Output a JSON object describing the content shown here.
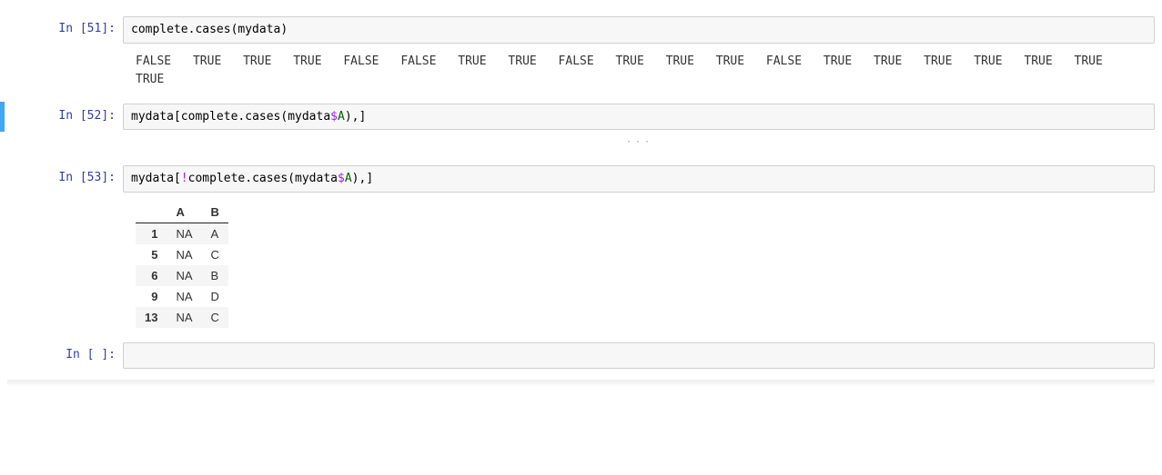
{
  "cells": {
    "c51": {
      "prompt": "In [51]:",
      "code": {
        "fn": "complete.cases",
        "lpar": "(",
        "arg": "mydata",
        "rpar": ")"
      },
      "output_text": "FALSE TRUE TRUE TRUE FALSE FALSE TRUE TRUE FALSE TRUE TRUE TRUE FALSE TRUE TRUE TRUE TRUE TRUE TRUE TRUE"
    },
    "c52": {
      "prompt": "In [52]:",
      "code": {
        "obj": "mydata",
        "lbrk": "[",
        "fn": "complete.cases",
        "lpar": "(",
        "arg": "mydata",
        "dollar": "$",
        "field": "A",
        "rpar": ")",
        "comma": ",",
        "rbrk": "]"
      },
      "ellipsis": "···"
    },
    "c53": {
      "prompt": "In [53]:",
      "code": {
        "obj": "mydata",
        "lbrk": "[",
        "bang": "!",
        "fn": "complete.cases",
        "lpar": "(",
        "arg": "mydata",
        "dollar": "$",
        "field": "A",
        "rpar": ")",
        "comma": ",",
        "rbrk": "]"
      },
      "table": {
        "columns": [
          "A",
          "B"
        ],
        "rows": [
          {
            "idx": "1",
            "A": "NA",
            "B": "A"
          },
          {
            "idx": "5",
            "A": "NA",
            "B": "C"
          },
          {
            "idx": "6",
            "A": "NA",
            "B": "B"
          },
          {
            "idx": "9",
            "A": "NA",
            "B": "D"
          },
          {
            "idx": "13",
            "A": "NA",
            "B": "C"
          }
        ]
      }
    },
    "c_empty": {
      "prompt": "In [ ]:"
    }
  }
}
